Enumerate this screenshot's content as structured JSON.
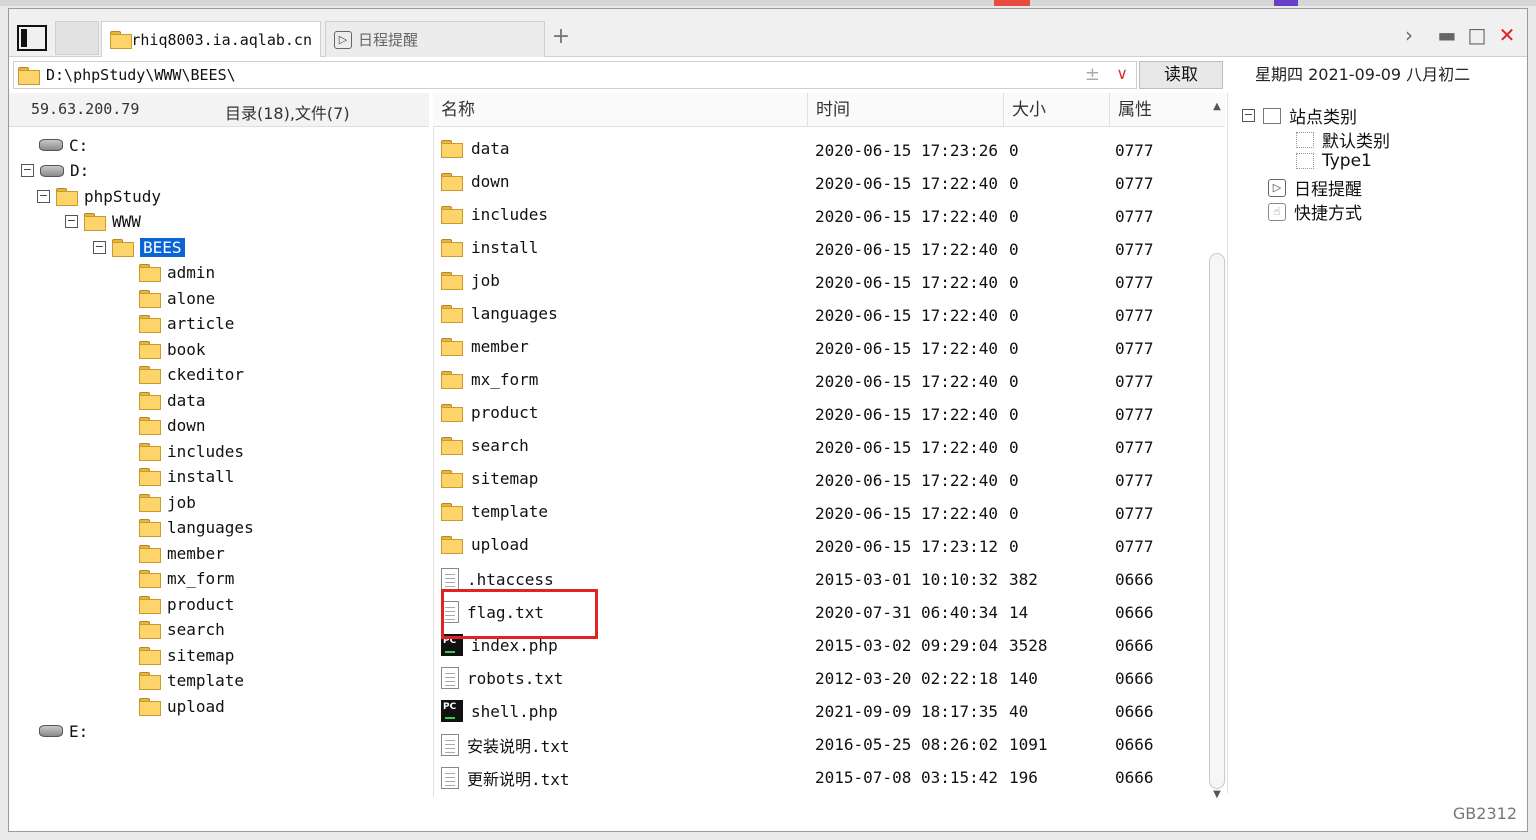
{
  "tabs": [
    {
      "label": "rhiq8003.ia.aqlab.cn",
      "active": true
    },
    {
      "label": "日程提醒",
      "active": false
    }
  ],
  "address": {
    "path": "D:\\phpStudy\\WWW\\BEES\\"
  },
  "read_button": "读取",
  "date": "星期四 2021-09-09 八月初二",
  "left": {
    "ip": "59.63.200.79",
    "counts": "目录(18),文件(7)",
    "tree": [
      {
        "label": "C:",
        "type": "drive",
        "level": 0,
        "expander": ""
      },
      {
        "label": "D:",
        "type": "drive",
        "level": 0,
        "expander": "⊟"
      },
      {
        "label": "phpStudy",
        "type": "folder",
        "level": 1,
        "expander": "⊟"
      },
      {
        "label": "WWW",
        "type": "folder",
        "level": 2,
        "expander": "⊟"
      },
      {
        "label": "BEES",
        "type": "folder",
        "level": 3,
        "expander": "⊟",
        "selected": true
      },
      {
        "label": "admin",
        "type": "folder",
        "level": 4
      },
      {
        "label": "alone",
        "type": "folder",
        "level": 4
      },
      {
        "label": "article",
        "type": "folder",
        "level": 4
      },
      {
        "label": "book",
        "type": "folder",
        "level": 4
      },
      {
        "label": "ckeditor",
        "type": "folder",
        "level": 4
      },
      {
        "label": "data",
        "type": "folder",
        "level": 4
      },
      {
        "label": "down",
        "type": "folder",
        "level": 4
      },
      {
        "label": "includes",
        "type": "folder",
        "level": 4
      },
      {
        "label": "install",
        "type": "folder",
        "level": 4
      },
      {
        "label": "job",
        "type": "folder",
        "level": 4
      },
      {
        "label": "languages",
        "type": "folder",
        "level": 4
      },
      {
        "label": "member",
        "type": "folder",
        "level": 4
      },
      {
        "label": "mx_form",
        "type": "folder",
        "level": 4
      },
      {
        "label": "product",
        "type": "folder",
        "level": 4
      },
      {
        "label": "search",
        "type": "folder",
        "level": 4
      },
      {
        "label": "sitemap",
        "type": "folder",
        "level": 4
      },
      {
        "label": "template",
        "type": "folder",
        "level": 4
      },
      {
        "label": "upload",
        "type": "folder",
        "level": 4
      },
      {
        "label": "E:",
        "type": "drive",
        "level": 0,
        "expander": ""
      }
    ]
  },
  "columns": {
    "name": "名称",
    "time": "时间",
    "size": "大小",
    "attr": "属性"
  },
  "files": [
    {
      "name": "data",
      "time": "2020-06-15 17:23:26",
      "size": "0",
      "attr": "0777",
      "icon": "folder"
    },
    {
      "name": "down",
      "time": "2020-06-15 17:22:40",
      "size": "0",
      "attr": "0777",
      "icon": "folder"
    },
    {
      "name": "includes",
      "time": "2020-06-15 17:22:40",
      "size": "0",
      "attr": "0777",
      "icon": "folder"
    },
    {
      "name": "install",
      "time": "2020-06-15 17:22:40",
      "size": "0",
      "attr": "0777",
      "icon": "folder"
    },
    {
      "name": "job",
      "time": "2020-06-15 17:22:40",
      "size": "0",
      "attr": "0777",
      "icon": "folder"
    },
    {
      "name": "languages",
      "time": "2020-06-15 17:22:40",
      "size": "0",
      "attr": "0777",
      "icon": "folder"
    },
    {
      "name": "member",
      "time": "2020-06-15 17:22:40",
      "size": "0",
      "attr": "0777",
      "icon": "folder"
    },
    {
      "name": "mx_form",
      "time": "2020-06-15 17:22:40",
      "size": "0",
      "attr": "0777",
      "icon": "folder"
    },
    {
      "name": "product",
      "time": "2020-06-15 17:22:40",
      "size": "0",
      "attr": "0777",
      "icon": "folder"
    },
    {
      "name": "search",
      "time": "2020-06-15 17:22:40",
      "size": "0",
      "attr": "0777",
      "icon": "folder"
    },
    {
      "name": "sitemap",
      "time": "2020-06-15 17:22:40",
      "size": "0",
      "attr": "0777",
      "icon": "folder"
    },
    {
      "name": "template",
      "time": "2020-06-15 17:22:40",
      "size": "0",
      "attr": "0777",
      "icon": "folder"
    },
    {
      "name": "upload",
      "time": "2020-06-15 17:23:12",
      "size": "0",
      "attr": "0777",
      "icon": "folder"
    },
    {
      "name": ".htaccess",
      "time": "2015-03-01 10:10:32",
      "size": "382",
      "attr": "0666",
      "icon": "file"
    },
    {
      "name": "flag.txt",
      "time": "2020-07-31 06:40:34",
      "size": "14",
      "attr": "0666",
      "icon": "file"
    },
    {
      "name": "index.php",
      "time": "2015-03-02 09:29:04",
      "size": "3528",
      "attr": "0666",
      "icon": "pc"
    },
    {
      "name": "robots.txt",
      "time": "2012-03-20 02:22:18",
      "size": "140",
      "attr": "0666",
      "icon": "file"
    },
    {
      "name": "shell.php",
      "time": "2021-09-09 18:17:35",
      "size": "40",
      "attr": "0666",
      "icon": "pc"
    },
    {
      "name": "安装说明.txt",
      "time": "2016-05-25 08:26:02",
      "size": "1091",
      "attr": "0666",
      "icon": "file"
    },
    {
      "name": "更新说明.txt",
      "time": "2015-07-08 03:15:42",
      "size": "196",
      "attr": "0666",
      "icon": "file"
    }
  ],
  "right": {
    "items": [
      {
        "label": "站点类别",
        "level": 0,
        "icon": "box-icon",
        "expander": "⊟"
      },
      {
        "label": "默认类别",
        "level": 1,
        "icon": "dotted-box-icon"
      },
      {
        "label": "Type1",
        "level": 1,
        "icon": "dotted-box-icon"
      },
      {
        "label": "日程提醒",
        "level": 0,
        "icon": "clock-icon"
      },
      {
        "label": "快捷方式",
        "level": 0,
        "icon": "hand-icon"
      }
    ]
  },
  "status": "GB2312",
  "colors": {
    "highlight": "#e02424",
    "selection": "#0a64d6",
    "folder": "#fcd46a"
  }
}
